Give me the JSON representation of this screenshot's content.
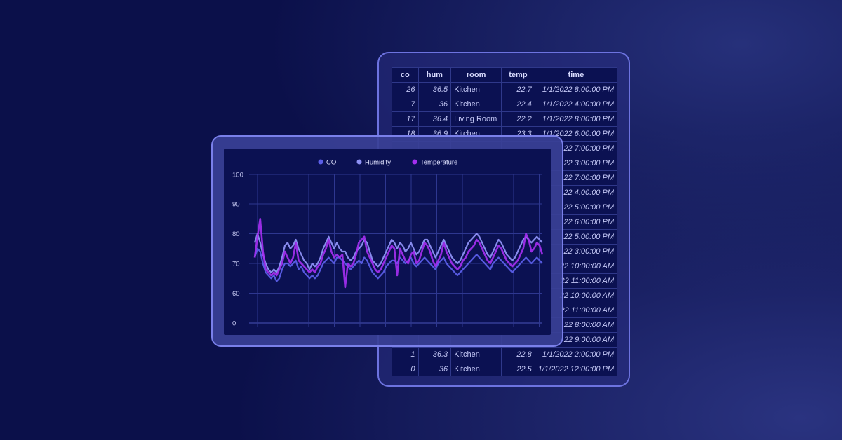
{
  "table": {
    "columns": [
      "co",
      "hum",
      "room",
      "temp",
      "time"
    ],
    "rows": [
      [
        "26",
        "36.5",
        "Kitchen",
        "22.7",
        "1/1/2022 8:00:00 PM"
      ],
      [
        "7",
        "36",
        "Kitchen",
        "22.4",
        "1/1/2022 4:00:00 PM"
      ],
      [
        "17",
        "36.4",
        "Living Room",
        "22.2",
        "1/1/2022 8:00:00 PM"
      ],
      [
        "18",
        "36.9",
        "Kitchen",
        "23.3",
        "1/1/2022 6:00:00 PM"
      ],
      [
        "",
        "",
        "",
        "",
        "22 7:00:00 PM"
      ],
      [
        "",
        "",
        "",
        "",
        "22 3:00:00 PM"
      ],
      [
        "",
        "",
        "",
        "",
        "22 7:00:00 PM"
      ],
      [
        "",
        "",
        "",
        "",
        "22 4:00:00 PM"
      ],
      [
        "",
        "",
        "",
        "",
        "22 5:00:00 PM"
      ],
      [
        "",
        "",
        "",
        "",
        "22 6:00:00 PM"
      ],
      [
        "",
        "",
        "",
        "",
        "22 5:00:00 PM"
      ],
      [
        "",
        "",
        "",
        "",
        "22 3:00:00 PM"
      ],
      [
        "",
        "",
        "",
        "",
        "22 10:00:00 AM"
      ],
      [
        "",
        "",
        "",
        "",
        "22 11:00:00 AM"
      ],
      [
        "",
        "",
        "",
        "",
        "22 10:00:00 AM"
      ],
      [
        "",
        "",
        "",
        "",
        "22 11:00:00 AM"
      ],
      [
        "",
        "",
        "",
        "",
        "22 8:00:00 AM"
      ],
      [
        "",
        "",
        "",
        "",
        "22 9:00:00 AM"
      ],
      [
        "1",
        "36.3",
        "Kitchen",
        "22.8",
        "1/1/2022 2:00:00 PM"
      ],
      [
        "0",
        "36",
        "Kitchen",
        "22.5",
        "1/1/2022 12:00:00 PM"
      ]
    ]
  },
  "chart_data": {
    "type": "line",
    "title": "",
    "xlabel": "",
    "ylabel": "",
    "ylim": [
      0,
      100
    ],
    "yticks": [
      0,
      60,
      70,
      80,
      90,
      100
    ],
    "grid": true,
    "legend_position": "top-center",
    "x": [
      0,
      4,
      8,
      12,
      16,
      20,
      24,
      28,
      32,
      36,
      40,
      44,
      48,
      52,
      56,
      60,
      64,
      68,
      72,
      76,
      80,
      84,
      88,
      92,
      96,
      100,
      104,
      108,
      112,
      116,
      120,
      124,
      128,
      132,
      136,
      140,
      144,
      148,
      152,
      156,
      160,
      164,
      168,
      172,
      176,
      180,
      184,
      188,
      192,
      196,
      200,
      204,
      208,
      212,
      216,
      220,
      224,
      228,
      232,
      236,
      240,
      244,
      248,
      252,
      256,
      260,
      264,
      268,
      272,
      276,
      280,
      284,
      288,
      292,
      296,
      300,
      304,
      308,
      312,
      316,
      320,
      324,
      328,
      332,
      336,
      340,
      344,
      348,
      352,
      356,
      360,
      364,
      368,
      372,
      376,
      380,
      384,
      388,
      392,
      396,
      400,
      404,
      408,
      412,
      416,
      420
    ],
    "series": [
      {
        "name": "CO",
        "color": "#5b5ee8",
        "values": [
          72,
          75,
          74,
          70,
          67,
          66,
          65,
          66,
          64,
          65,
          68,
          70,
          70,
          69,
          70,
          71,
          68,
          69,
          67,
          66,
          65,
          66,
          65,
          66,
          68,
          70,
          71,
          72,
          71,
          70,
          72,
          72,
          71,
          70,
          69,
          68,
          69,
          70,
          71,
          70,
          72,
          71,
          69,
          67,
          66,
          65,
          66,
          67,
          69,
          70,
          71,
          71,
          70,
          72,
          71,
          70,
          71,
          72,
          70,
          69,
          70,
          71,
          72,
          71,
          70,
          69,
          68,
          70,
          71,
          72,
          70,
          69,
          68,
          67,
          66,
          67,
          68,
          69,
          70,
          71,
          72,
          73,
          72,
          71,
          70,
          69,
          68,
          70,
          71,
          72,
          71,
          70,
          69,
          68,
          67,
          68,
          69,
          70,
          71,
          72,
          71,
          70,
          71,
          72,
          71,
          70
        ]
      },
      {
        "name": "Humidity",
        "color": "#8e91f5",
        "values": [
          77,
          80,
          77,
          73,
          70,
          68,
          67,
          68,
          67,
          69,
          72,
          76,
          77,
          75,
          76,
          78,
          75,
          73,
          71,
          70,
          68,
          70,
          69,
          70,
          72,
          75,
          77,
          79,
          77,
          75,
          77,
          75,
          74,
          74,
          72,
          71,
          72,
          74,
          75,
          76,
          78,
          77,
          74,
          71,
          70,
          69,
          70,
          72,
          74,
          76,
          78,
          77,
          75,
          77,
          76,
          74,
          75,
          77,
          75,
          73,
          74,
          76,
          78,
          78,
          76,
          74,
          72,
          74,
          76,
          78,
          76,
          74,
          72,
          71,
          70,
          71,
          73,
          75,
          77,
          78,
          79,
          80,
          79,
          77,
          75,
          73,
          72,
          74,
          76,
          78,
          77,
          75,
          73,
          72,
          71,
          72,
          74,
          76,
          78,
          79,
          78,
          77,
          78,
          79,
          78,
          77
        ]
      },
      {
        "name": "Temperature",
        "color": "#a42ff0",
        "values": [
          72,
          79,
          85,
          74,
          68,
          67,
          66,
          67,
          66,
          68,
          70,
          74,
          72,
          70,
          72,
          77,
          71,
          70,
          69,
          68,
          67,
          68,
          67,
          69,
          70,
          73,
          75,
          78,
          74,
          72,
          73,
          72,
          73,
          62,
          70,
          69,
          70,
          73,
          77,
          78,
          79,
          74,
          72,
          70,
          68,
          67,
          68,
          70,
          72,
          74,
          76,
          75,
          66,
          75,
          73,
          71,
          70,
          73,
          74,
          70,
          71,
          74,
          77,
          76,
          74,
          71,
          69,
          71,
          73,
          77,
          74,
          72,
          70,
          69,
          68,
          69,
          71,
          72,
          74,
          75,
          76,
          78,
          77,
          75,
          73,
          71,
          70,
          72,
          74,
          76,
          75,
          73,
          71,
          70,
          69,
          70,
          71,
          73,
          75,
          80,
          78,
          74,
          75,
          77,
          76,
          73
        ]
      }
    ]
  }
}
